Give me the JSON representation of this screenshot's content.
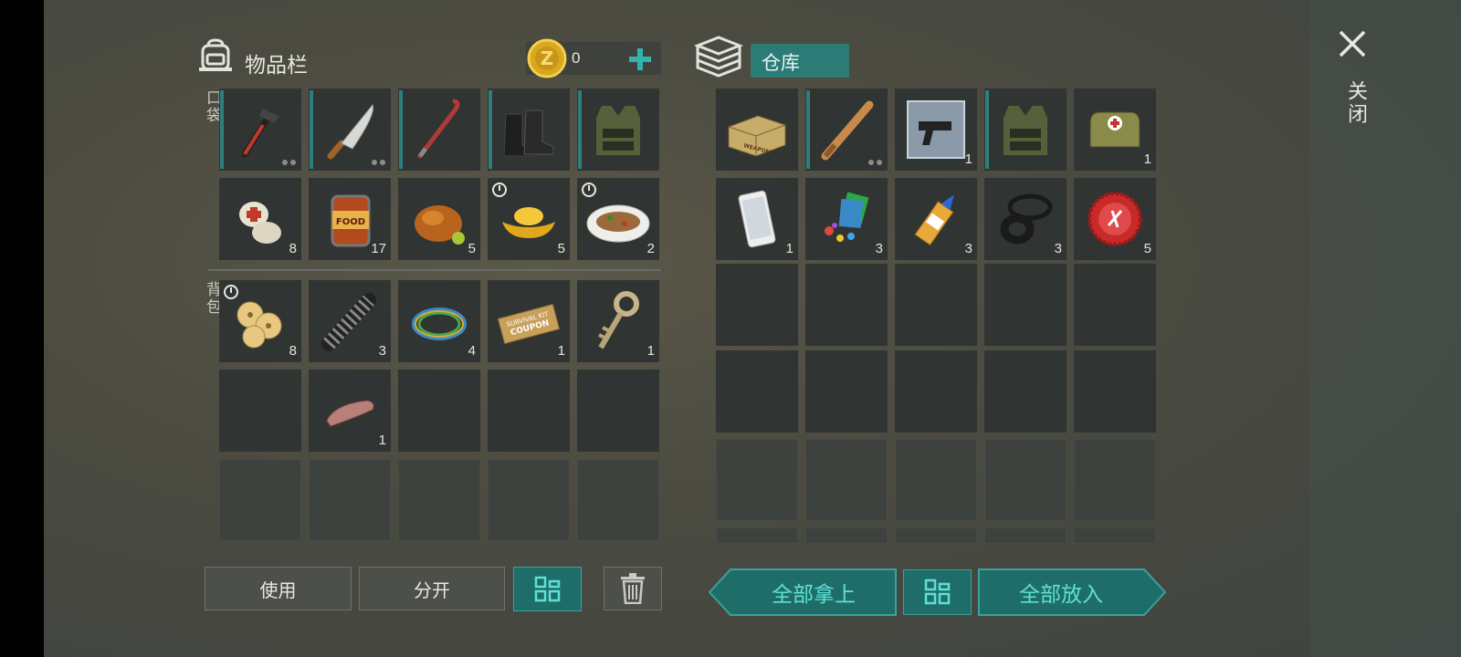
{
  "inventory": {
    "title": "物品栏",
    "coins": "0",
    "pockets_label": "口袋",
    "backpack_label": "背包",
    "pocket_items": [
      {
        "icon": "hammer-wrench-icon",
        "count": "",
        "dots": 2,
        "equipped": true
      },
      {
        "icon": "machete-icon",
        "count": "",
        "dots": 2,
        "equipped": true
      },
      {
        "icon": "crowbar-icon",
        "count": "",
        "dots": 0,
        "equipped": true
      },
      {
        "icon": "combat-boots-icon",
        "count": "",
        "dots": 0,
        "equipped": true
      },
      {
        "icon": "tactical-vest-icon",
        "count": "",
        "dots": 0,
        "equipped": true
      },
      {
        "icon": "bandage-icon",
        "count": "8"
      },
      {
        "icon": "canned-food-icon",
        "count": "17",
        "label": "FOOD"
      },
      {
        "icon": "roast-chicken-icon",
        "count": "5"
      },
      {
        "icon": "gold-ingot-icon",
        "count": "5",
        "timer": true
      },
      {
        "icon": "fish-dish-icon",
        "count": "2",
        "timer": true
      }
    ],
    "backpack_items": [
      {
        "icon": "lotus-root-dish-icon",
        "count": "8",
        "timer": true
      },
      {
        "icon": "spring-icon",
        "count": "3"
      },
      {
        "icon": "wire-coil-icon",
        "count": "4"
      },
      {
        "icon": "coupon-icon",
        "count": "1",
        "text1": "SURVIVAL KIT",
        "text2": "COUPON"
      },
      {
        "icon": "key-icon",
        "count": "1"
      },
      {
        "icon": "",
        "count": ""
      },
      {
        "icon": "finger-icon",
        "count": "1"
      },
      {
        "icon": "",
        "count": ""
      },
      {
        "icon": "",
        "count": ""
      },
      {
        "icon": "",
        "count": ""
      }
    ],
    "buttons": {
      "use": "使用",
      "split": "分开"
    }
  },
  "storage": {
    "title": "仓库",
    "items": [
      {
        "icon": "weapon-crate-icon",
        "count": "",
        "label": "WEAPON"
      },
      {
        "icon": "baseball-bat-icon",
        "count": "",
        "dots": 2,
        "equipped": true
      },
      {
        "icon": "pistol-blueprint-icon",
        "count": "1"
      },
      {
        "icon": "tactical-vest-icon",
        "count": "",
        "equipped": true
      },
      {
        "icon": "medkit-bag-icon",
        "count": "1"
      },
      {
        "icon": "smartphone-icon",
        "count": "1"
      },
      {
        "icon": "scrap-pieces-icon",
        "count": "3"
      },
      {
        "icon": "glue-tube-icon",
        "count": "3"
      },
      {
        "icon": "rubber-seals-icon",
        "count": "3"
      },
      {
        "icon": "bottle-cap-icon",
        "count": "5"
      }
    ],
    "buttons": {
      "take_all": "全部拿上",
      "put_all": "全部放入"
    }
  },
  "close_label": "关闭",
  "colors": {
    "accent": "#2f8f8b",
    "accent_text": "#5fe0d6",
    "slot": "#303432"
  }
}
